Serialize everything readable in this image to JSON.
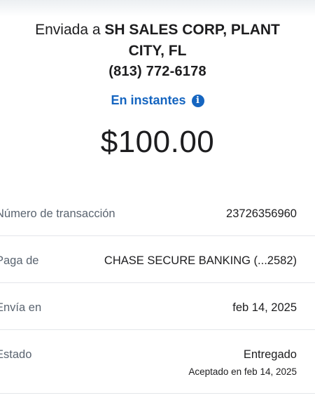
{
  "recipient": {
    "prefix": "Enviada a",
    "name_line1": "SH SALES CORP, PLANT",
    "name_line2": "CITY, FL",
    "phone": "(813) 772-6178"
  },
  "delivery_speed": {
    "label": "En instantes",
    "icon": "info-icon"
  },
  "amount": "$100.00",
  "details": {
    "transaction": {
      "label": "Número de transacción",
      "value": "23726356960"
    },
    "paid_from": {
      "label": "Paga de",
      "value": "CHASE SECURE BANKING (...2582)"
    },
    "sent_on": {
      "label": "Envía en",
      "value": "feb 14, 2025"
    },
    "status": {
      "label": "Estado",
      "value": "Entregado",
      "sub": "Aceptado en feb 14, 2025"
    }
  },
  "colors": {
    "accent": "#1565c0",
    "text": "#1d1d1f",
    "label": "#5a6470",
    "divider": "#e3e6ea"
  }
}
